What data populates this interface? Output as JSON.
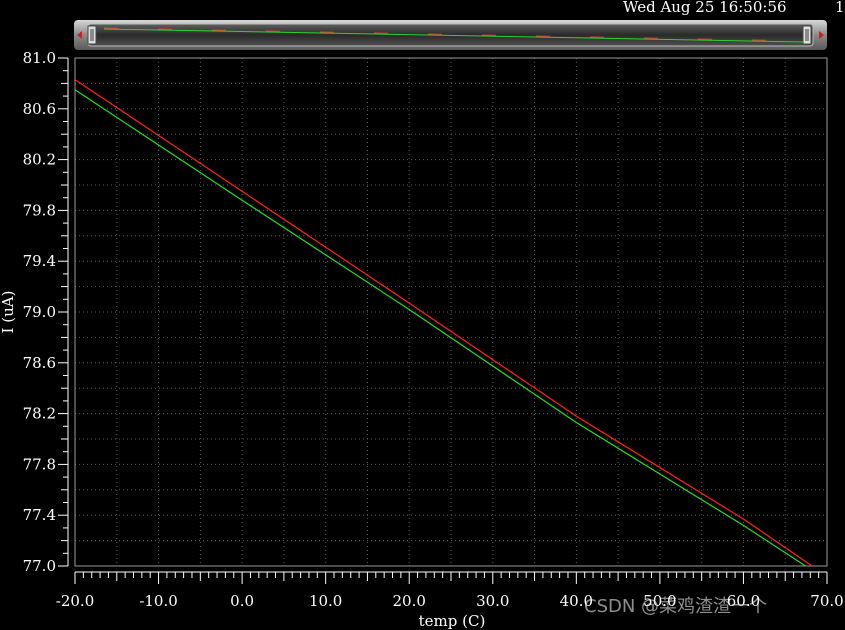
{
  "header": {
    "datetime": "Wed Aug 25 16:50:56",
    "page": "1"
  },
  "watermark": "CSDN @菜鸡渣渣一个",
  "colors": {
    "background": "#000000",
    "grid": "#5a5a5a",
    "series_red": "#ff2020",
    "series_green": "#20e020",
    "axis_text": "#ffffff"
  },
  "chart_data": {
    "type": "line",
    "title": "",
    "xlabel": "temp (C)",
    "ylabel": "I (uA)",
    "xlim": [
      -20,
      70
    ],
    "ylim": [
      77.0,
      81.0
    ],
    "xticks": [
      -20,
      -10,
      0,
      10,
      20,
      30,
      40,
      50,
      60,
      70
    ],
    "xtick_labels": [
      "-20.0",
      "-10.0",
      "0.0",
      "10.0",
      "20.0",
      "30.0",
      "40.0",
      "50.0",
      "60.0",
      "70.0"
    ],
    "yticks": [
      77.0,
      77.4,
      77.8,
      78.2,
      78.6,
      79.0,
      79.4,
      79.8,
      80.2,
      80.6,
      81.0
    ],
    "ytick_labels": [
      "77.0",
      "77.4",
      "77.8",
      "78.2",
      "78.6",
      "79.0",
      "79.4",
      "79.8",
      "80.2",
      "80.6",
      "81.0"
    ],
    "grid": true,
    "series": [
      {
        "color": "red",
        "x": [
          -20,
          0,
          20,
          40,
          60,
          70
        ],
        "y": [
          80.83,
          79.95,
          79.07,
          78.18,
          77.37,
          76.92
        ]
      },
      {
        "color": "green",
        "x": [
          -20,
          0,
          20,
          40,
          60,
          70
        ],
        "y": [
          80.75,
          79.88,
          79.02,
          78.13,
          77.32,
          76.89
        ]
      }
    ]
  }
}
